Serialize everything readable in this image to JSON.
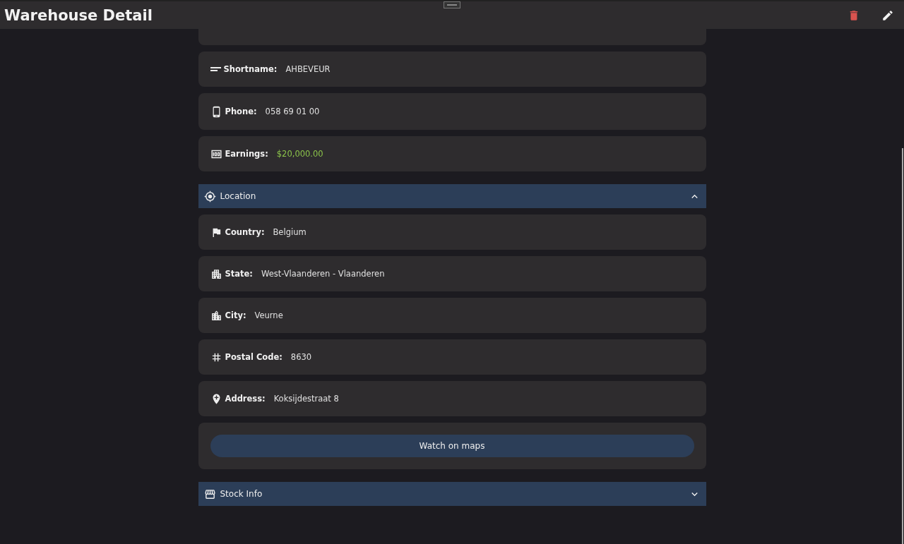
{
  "header": {
    "title": "Warehouse Detail"
  },
  "general_fields": [
    {
      "label": "Shortname:",
      "value": "AHBEVEUR",
      "kind": "text"
    },
    {
      "label": "Phone:",
      "value": "058 69 01 00",
      "kind": "text"
    },
    {
      "label": "Earnings:",
      "value": "$20,000.00",
      "kind": "money"
    }
  ],
  "sections": [
    {
      "title": "Location",
      "expanded": true,
      "fields": [
        {
          "label": "Country:",
          "value": "Belgium"
        },
        {
          "label": "State:",
          "value": "West-Vlaanderen - Vlaanderen"
        },
        {
          "label": "City:",
          "value": "Veurne"
        },
        {
          "label": "Postal Code:",
          "value": "8630"
        },
        {
          "label": "Address:",
          "value": "Koksijdestraat 8"
        }
      ],
      "button": "Watch on maps"
    },
    {
      "title": "Stock Info",
      "expanded": false
    }
  ]
}
